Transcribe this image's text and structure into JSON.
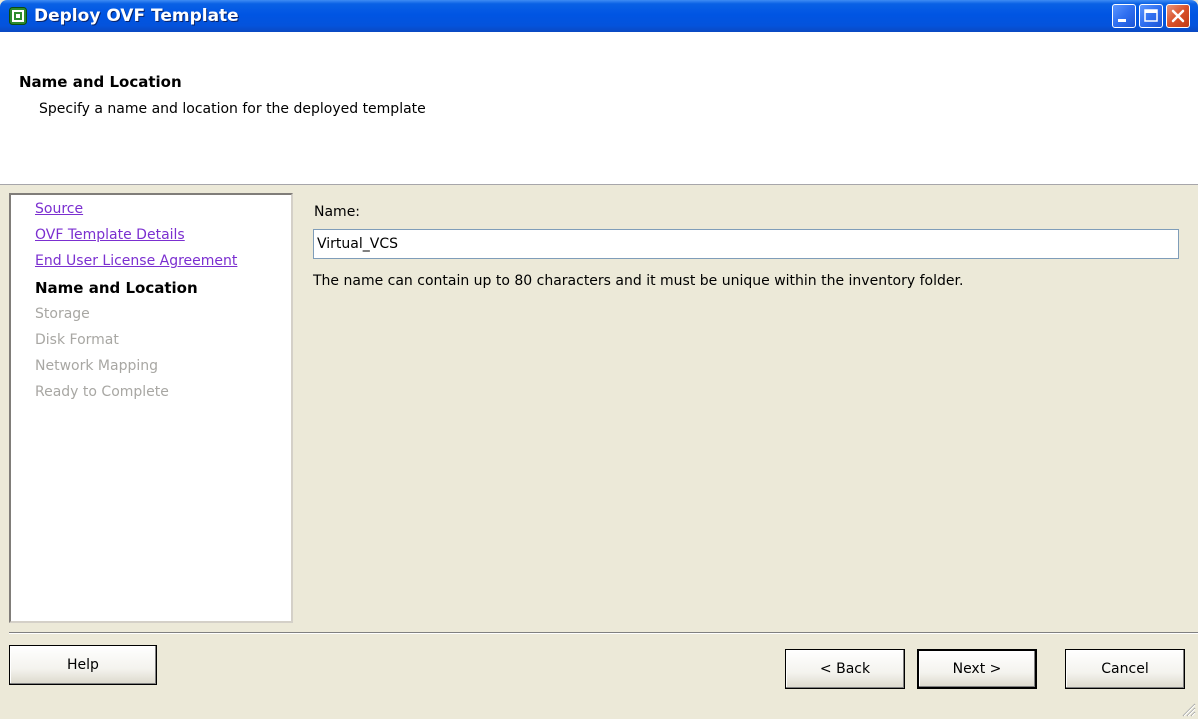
{
  "window": {
    "title": "Deploy OVF Template",
    "title_bar_color": "#0055e3",
    "controls": [
      "minimize-icon",
      "maximize-icon",
      "close-icon"
    ]
  },
  "header": {
    "title": "Name and Location",
    "description": "Specify a name and location for the deployed template"
  },
  "steps": [
    {
      "label": "Source",
      "state": "completed"
    },
    {
      "label": "OVF Template Details",
      "state": "completed"
    },
    {
      "label": "End User License Agreement",
      "state": "completed"
    },
    {
      "label": "Name and Location",
      "state": "current"
    },
    {
      "label": "Storage",
      "state": "pending"
    },
    {
      "label": "Disk Format",
      "state": "pending"
    },
    {
      "label": "Network Mapping",
      "state": "pending"
    },
    {
      "label": "Ready to Complete",
      "state": "pending"
    }
  ],
  "form": {
    "name_label": "Name:",
    "name_value": "Virtual_VCS",
    "hint": "The name can contain up to 80 characters and it must be unique within the inventory folder."
  },
  "buttons": {
    "help": "Help",
    "back": "< Back",
    "next": "Next >",
    "cancel": "Cancel"
  },
  "colors": {
    "link": "#7b2fd0",
    "disabled": "#a8a7a3",
    "dialog_bg": "#ece9d8"
  }
}
